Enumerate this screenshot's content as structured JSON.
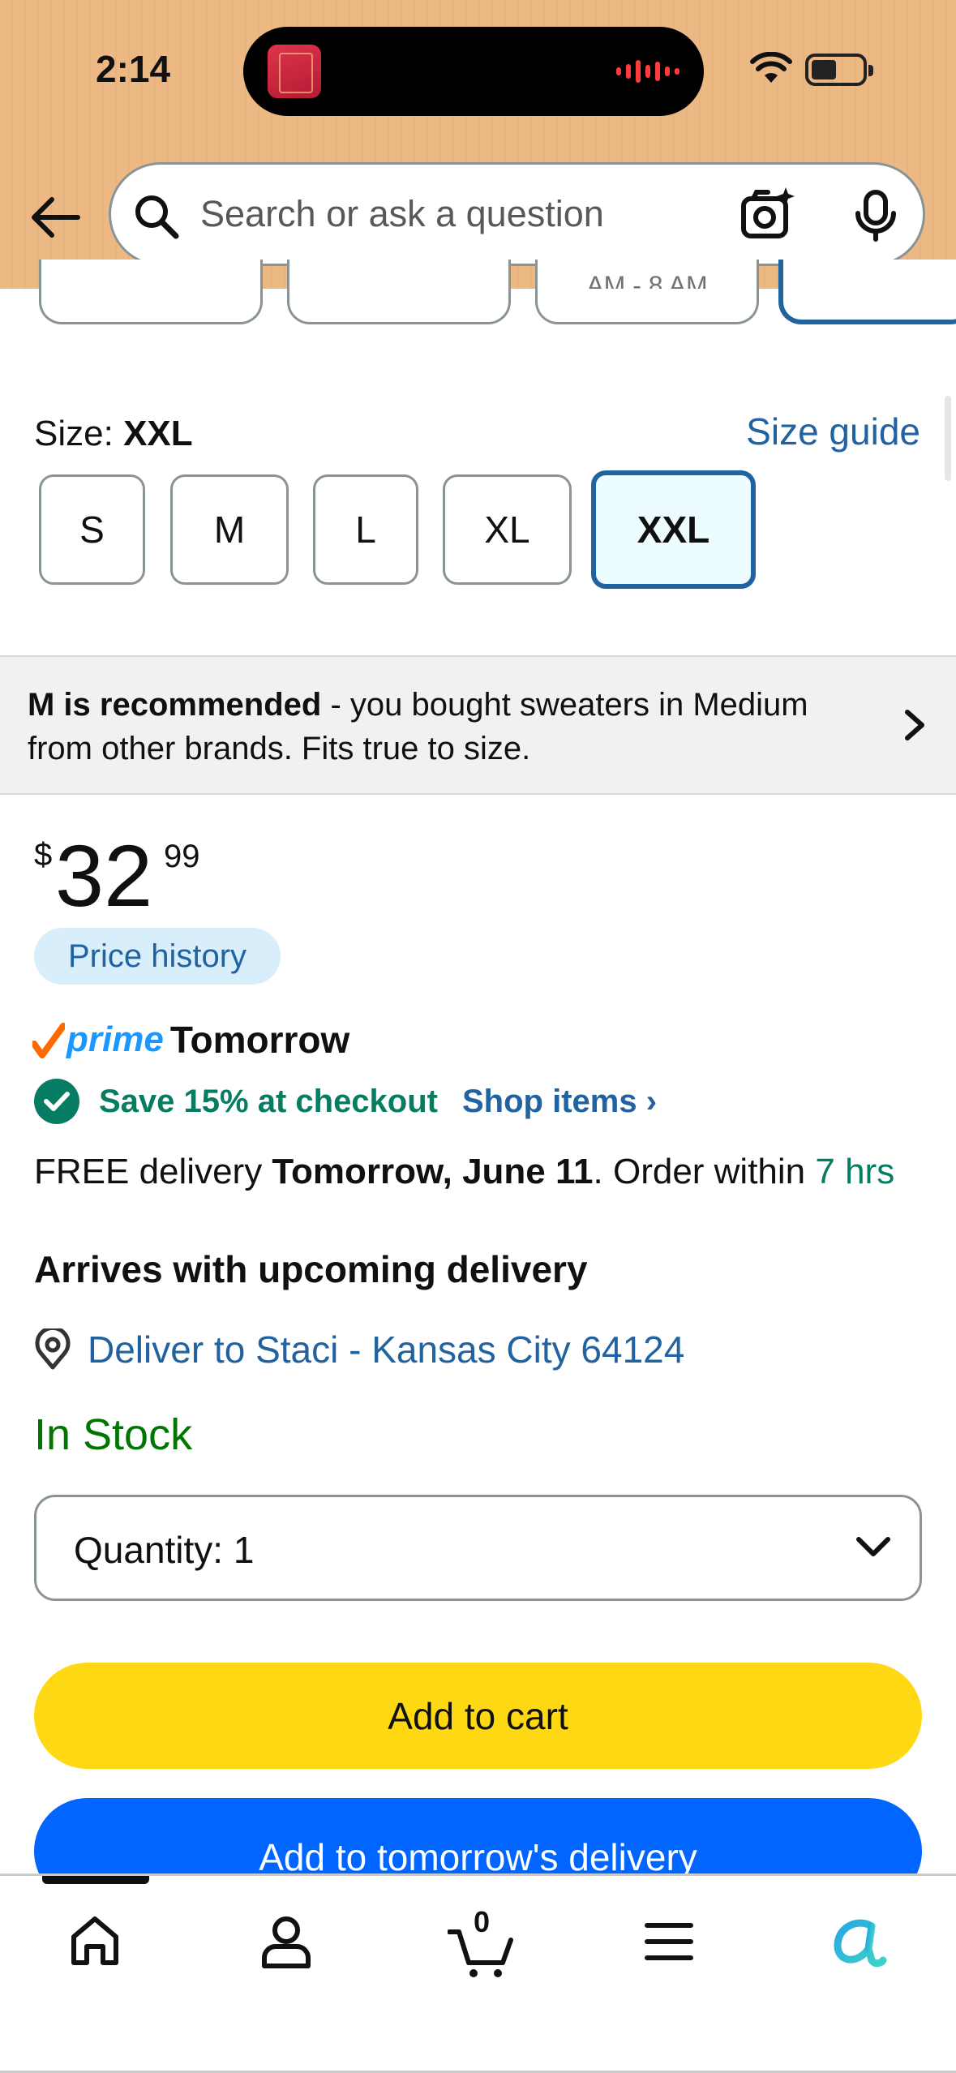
{
  "status_bar": {
    "time": "2:14"
  },
  "search": {
    "placeholder": "Search or ask a question"
  },
  "variations": [
    {
      "label": ""
    },
    {
      "label": ""
    },
    {
      "label": "AM - 8 AM"
    },
    {
      "label": ""
    }
  ],
  "size": {
    "label": "Size:",
    "selected": "XXL",
    "guide_link": "Size guide",
    "options": [
      "S",
      "M",
      "L",
      "XL",
      "XXL"
    ]
  },
  "recommendation": {
    "bold": "M is recommended",
    "text": " - you bought sweaters in Medium from other brands. Fits true to size."
  },
  "price": {
    "currency": "$",
    "whole": "32",
    "fraction": "99",
    "history_label": "Price history"
  },
  "prime": {
    "word": "prime",
    "speed": "Tomorrow"
  },
  "promo": {
    "text": "Save 15% at checkout",
    "link": "Shop items ›"
  },
  "delivery": {
    "prefix": "FREE delivery ",
    "date": "Tomorrow, June 11",
    "middle": ". Order within ",
    "countdown": "7 hrs",
    "arrives": "Arrives with upcoming delivery",
    "deliver_to": "Deliver to Staci - Kansas City 64124"
  },
  "stock": {
    "status": "In Stock"
  },
  "quantity": {
    "label": "Quantity:",
    "value": "1"
  },
  "actions": {
    "add_to_cart": "Add to cart",
    "add_to_delivery": "Add to tomorrow's delivery"
  },
  "bottom_nav": {
    "items": [
      "home-icon",
      "account-icon",
      "cart-icon",
      "menu-icon",
      "rufus-icon"
    ],
    "cart_count": "0"
  },
  "colors": {
    "header_bg": "#ecb985",
    "link_blue": "#2162a1",
    "success_green": "#067d62",
    "in_stock_green": "#007600",
    "cart_yellow": "#ffd814",
    "delivery_blue": "#0066ff"
  }
}
